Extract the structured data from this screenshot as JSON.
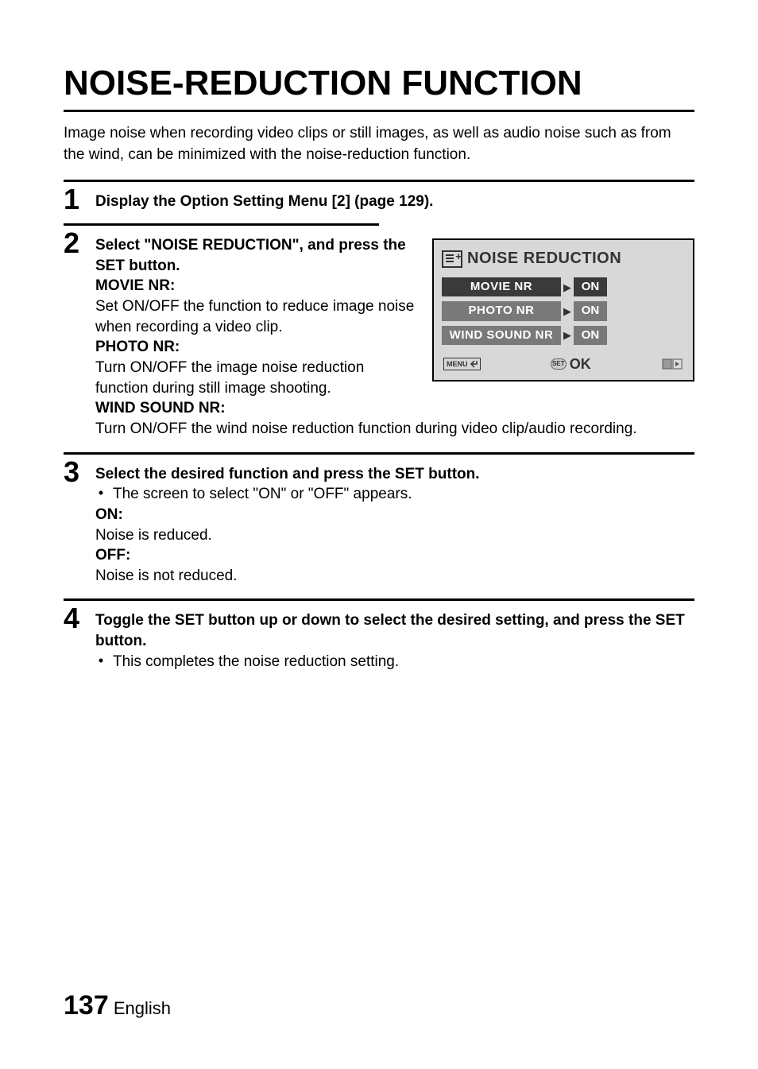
{
  "title": "NOISE-REDUCTION FUNCTION",
  "intro": "Image noise when recording video clips or still images, as well as audio noise such as from the wind, can be minimized with the noise-reduction function.",
  "step1": {
    "bold": "Display the Option Setting Menu [2] (page 129)."
  },
  "step2": {
    "bold1": "Select \"NOISE REDUCTION\", and press the SET button.",
    "label_movie": "MOVIE NR:",
    "desc_movie": "Set ON/OFF the function to reduce image noise when recording a video clip.",
    "label_photo": "PHOTO NR:",
    "desc_photo": "Turn ON/OFF the image noise reduction function during still image shooting.",
    "label_wind": "WIND SOUND NR:",
    "desc_wind": "Turn ON/OFF the wind noise reduction function during video clip/audio recording."
  },
  "lcd": {
    "title": "NOISE REDUCTION",
    "items": [
      {
        "label": "MOVIE NR",
        "value": "ON",
        "selected": true
      },
      {
        "label": "PHOTO NR",
        "value": "ON",
        "selected": false
      },
      {
        "label": "WIND SOUND NR",
        "value": "ON",
        "selected": false
      }
    ],
    "menu_label": "MENU",
    "ok_label": "OK",
    "set_label": "SET"
  },
  "step3": {
    "bold": "Select the desired function and press the SET button.",
    "bullet": "The screen to select \"ON\" or \"OFF\" appears.",
    "on_label": "ON:",
    "on_desc": "Noise is reduced.",
    "off_label": "OFF:",
    "off_desc": "Noise is not reduced."
  },
  "step4": {
    "bold": "Toggle the SET button up or down to select the desired setting, and press the SET button.",
    "bullet": "This completes the noise reduction setting."
  },
  "footer": {
    "page": "137",
    "lang": "English"
  }
}
